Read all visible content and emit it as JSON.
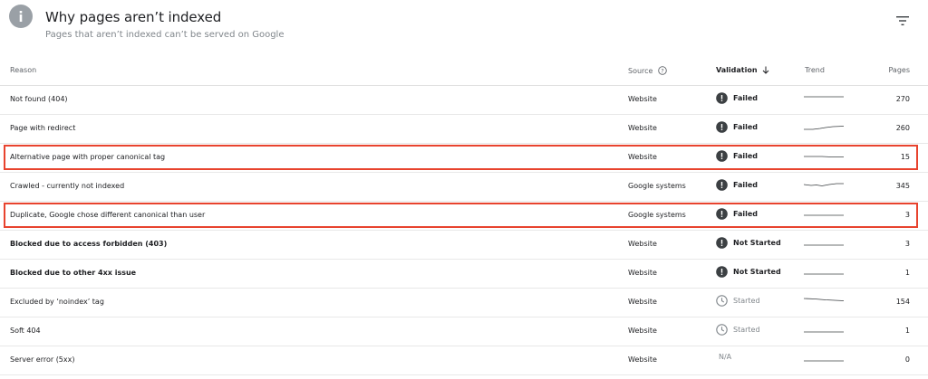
{
  "header": {
    "title": "Why pages aren’t indexed",
    "subtitle": "Pages that aren’t indexed can’t be served on Google",
    "info_icon": "info-icon",
    "filter_icon": "filter-icon"
  },
  "table": {
    "columns": {
      "reason": "Reason",
      "source": "Source",
      "validation": "Validation",
      "trend": "Trend",
      "pages": "Pages"
    },
    "rows": [
      {
        "reason": "Not found (404)",
        "source": "Website",
        "validation": "Failed",
        "status": "failed",
        "pages": "270",
        "bold": false
      },
      {
        "reason": "Page with redirect",
        "source": "Website",
        "validation": "Failed",
        "status": "failed",
        "pages": "260",
        "bold": false
      },
      {
        "reason": "Alternative page with proper canonical tag",
        "source": "Website",
        "validation": "Failed",
        "status": "failed",
        "pages": "15",
        "bold": false,
        "highlighted": true
      },
      {
        "reason": "Crawled - currently not indexed",
        "source": "Google systems",
        "validation": "Failed",
        "status": "failed",
        "pages": "345",
        "bold": false
      },
      {
        "reason": "Duplicate, Google chose different canonical than user",
        "source": "Google systems",
        "validation": "Failed",
        "status": "failed",
        "pages": "3",
        "bold": false,
        "highlighted": true
      },
      {
        "reason": "Blocked due to access forbidden (403)",
        "source": "Website",
        "validation": "Not Started",
        "status": "not-started",
        "pages": "3",
        "bold": true
      },
      {
        "reason": "Blocked due to other 4xx issue",
        "source": "Website",
        "validation": "Not Started",
        "status": "not-started",
        "pages": "1",
        "bold": true
      },
      {
        "reason": "Excluded by ‘noindex’ tag",
        "source": "Website",
        "validation": "Started",
        "status": "started",
        "pages": "154",
        "bold": false
      },
      {
        "reason": "Soft 404",
        "source": "Website",
        "validation": "Started",
        "status": "started",
        "pages": "1",
        "bold": false
      },
      {
        "reason": "Server error (5xx)",
        "source": "Website",
        "validation": "N/A",
        "status": "na",
        "pages": "0",
        "bold": false
      }
    ]
  },
  "colors": {
    "highlight": "#e8432e",
    "status_icon": "#3c4043",
    "muted": "#80868b"
  }
}
